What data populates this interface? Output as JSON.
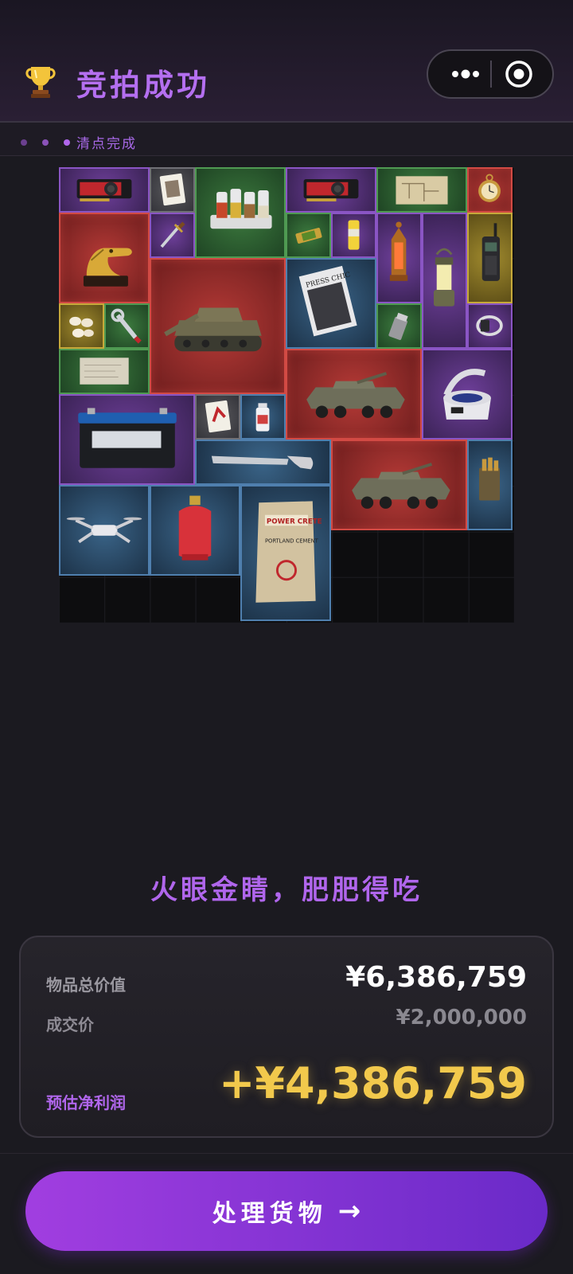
{
  "header": {
    "title": "竞拍成功",
    "trophy_icon": "trophy-icon",
    "menu_icon": "more-dots-icon",
    "close_icon": "target-icon"
  },
  "status_bar": {
    "status_text": "清点完成",
    "dot_colors": [
      "#6b3f8f",
      "#8a52b8",
      "#b066ec"
    ]
  },
  "inventory": {
    "rarity_colors": {
      "red": "#d24a44",
      "purple": "#8a55c4",
      "green": "#4f9a52",
      "blue": "#4f7fae",
      "gold": "#c7a93a",
      "gray": "#707076"
    },
    "items": [
      {
        "name": "graphics-card",
        "rarity": "purple"
      },
      {
        "name": "playing-card",
        "rarity": "gray"
      },
      {
        "name": "spice-rack",
        "rarity": "green"
      },
      {
        "name": "graphics-card",
        "rarity": "purple"
      },
      {
        "name": "map",
        "rarity": "green"
      },
      {
        "name": "pocket-watch",
        "rarity": "red"
      },
      {
        "name": "crocodile-statue",
        "rarity": "red"
      },
      {
        "name": "dagger",
        "rarity": "purple"
      },
      {
        "name": "candy-bar",
        "rarity": "green"
      },
      {
        "name": "energy-drink",
        "rarity": "purple"
      },
      {
        "name": "lantern-ornate",
        "rarity": "purple"
      },
      {
        "name": "camping-lantern",
        "rarity": "purple"
      },
      {
        "name": "walkie-talkie",
        "rarity": "gold"
      },
      {
        "name": "tank",
        "rarity": "red"
      },
      {
        "name": "magazine",
        "rarity": "blue"
      },
      {
        "name": "pearls",
        "rarity": "gold"
      },
      {
        "name": "wrench",
        "rarity": "green"
      },
      {
        "name": "lighter",
        "rarity": "green"
      },
      {
        "name": "smart-watch",
        "rarity": "purple"
      },
      {
        "name": "old-paper",
        "rarity": "green"
      },
      {
        "name": "armored-vehicle",
        "rarity": "red"
      },
      {
        "name": "centrifuge",
        "rarity": "purple"
      },
      {
        "name": "car-battery",
        "rarity": "purple"
      },
      {
        "name": "playing-card",
        "rarity": "gray"
      },
      {
        "name": "medicine-bottle",
        "rarity": "blue"
      },
      {
        "name": "hand-saw",
        "rarity": "blue"
      },
      {
        "name": "armored-vehicle",
        "rarity": "red"
      },
      {
        "name": "ammo-box",
        "rarity": "blue"
      },
      {
        "name": "drone",
        "rarity": "blue"
      },
      {
        "name": "gas-cylinder",
        "rarity": "blue"
      },
      {
        "name": "cement-bag",
        "rarity": "blue"
      }
    ],
    "cement_label_1": "POWER CRETE",
    "cement_label_2": "PORTLAND CEMENT",
    "magazine_title": "PRESS CHIC"
  },
  "slogan": "火眼金睛，肥肥得吃",
  "summary": {
    "total_value_label": "物品总价值",
    "total_value": "¥6,386,759",
    "deal_price_label": "成交价",
    "deal_price": "¥2,000,000",
    "profit_label": "预估净利润",
    "profit": "+¥4,386,759",
    "profit_color": "#f2c94c",
    "accent_color": "#b066ec"
  },
  "cta": {
    "label": "处理货物",
    "arrow": "→"
  }
}
